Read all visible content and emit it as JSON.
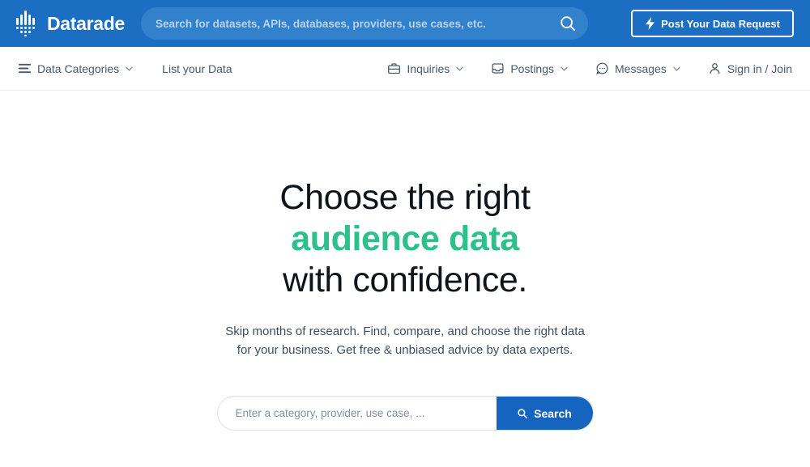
{
  "colors": {
    "header_blue": "#1b6ec2",
    "header_search_blue": "#3281cc",
    "accent_green": "#2ec08a",
    "button_blue": "#1565c0",
    "nav_text": "#4a5a6b",
    "headline_text": "#0f1419",
    "subhead_text": "#3d4e60"
  },
  "header": {
    "logo_icon": "datarade-dots-logo-icon",
    "brand_name": "Datarade",
    "search": {
      "placeholder": "Search for datasets, APIs, databases, providers, use cases, etc.",
      "value": "",
      "icon": "search-icon"
    },
    "post_request_button": {
      "label": "Post Your Data Request",
      "icon": "lightning-bolt-icon"
    }
  },
  "nav": {
    "left": [
      {
        "label": "Data Categories",
        "icon": "hamburger-menu-icon",
        "has_caret": true
      },
      {
        "label": "List your Data",
        "icon": "",
        "has_caret": false
      }
    ],
    "right": [
      {
        "label": "Inquiries",
        "icon": "briefcase-icon",
        "has_caret": true
      },
      {
        "label": "Postings",
        "icon": "inbox-tray-icon",
        "has_caret": true
      },
      {
        "label": "Messages",
        "icon": "chat-bubble-icon",
        "has_caret": true
      },
      {
        "label": "Sign in / Join",
        "icon": "person-icon",
        "has_caret": false
      }
    ]
  },
  "hero": {
    "headline_line1": "Choose the right",
    "headline_accent": "audience data",
    "headline_line3": "with confidence.",
    "subhead_line1": "Skip months of research. Find, compare, and choose the right data",
    "subhead_line2": "for your business. Get free & unbiased advice by data experts.",
    "search": {
      "placeholder": "Enter a category, provider, use case, ...",
      "value": "",
      "button_label": "Search",
      "button_icon": "search-icon"
    }
  }
}
